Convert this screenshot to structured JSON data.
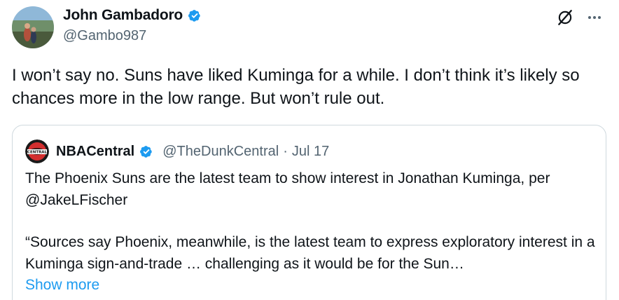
{
  "author": {
    "display_name": "John Gambadoro",
    "handle": "@Gambo987",
    "verified": true,
    "avatar_icon": "profile-photo"
  },
  "header_icons": {
    "grok": "grok-icon",
    "more": "more-icon"
  },
  "tweet": {
    "text": "I won’t say no. Suns have liked Kuminga for a while. I don’t think it’s likely so chances more in the low range. But won’t rule out."
  },
  "quoted_tweet": {
    "display_name": "NBACentral",
    "handle": "@TheDunkCentral",
    "separator": "·",
    "date": "Jul 17",
    "verified": true,
    "avatar_icon": "nba-central-logo",
    "paragraph_1": "The Phoenix Suns are the latest team to show interest in Jonathan Kuminga, per @JakeLFischer",
    "paragraph_2": "“Sources say Phoenix, meanwhile, is the latest team to express exploratory interest in a Kuminga sign-and-trade … challenging as it would be for the Sun…",
    "show_more": "Show more"
  },
  "colors": {
    "text": "#0f1419",
    "secondary": "#536471",
    "accent": "#1d9bf0",
    "border": "#cfd9de"
  }
}
